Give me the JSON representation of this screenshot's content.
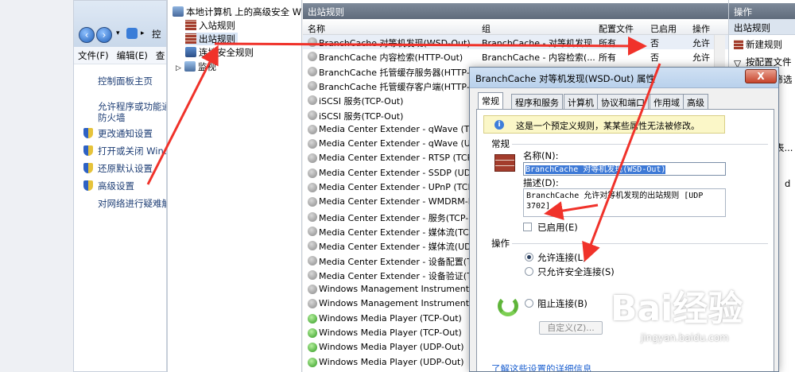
{
  "control_panel": {
    "address_fragment": "控",
    "menu": [
      "文件(F)",
      "编辑(E)",
      "查"
    ],
    "links": [
      "控制面板主页",
      "允许程序或功能通",
      "防火墙",
      "更改通知设置",
      "打开或关闭 Windo",
      "还原默认设置",
      "高级设置",
      "对网络进行疑难解"
    ]
  },
  "tree": {
    "root": "本地计算机 上的高级安全 Win",
    "inbound": "入站规则",
    "outbound": "出站规则",
    "connection": "连接安全规则",
    "monitor": "监视"
  },
  "list": {
    "title": "出站规则",
    "columns": {
      "name": "名称",
      "group": "组",
      "profile": "配置文件",
      "enabled": "已启用",
      "action": "操作"
    },
    "rows": [
      {
        "name": "BranchCache 对等机发现(WSD-Out)",
        "group": "BranchCache - 对等机发现",
        "profile": "所有",
        "enabled": "否",
        "action": "允许",
        "green": false
      },
      {
        "name": "BranchCache 内容检索(HTTP-Out)",
        "group": "BranchCache - 内容检索(...",
        "profile": "所有",
        "enabled": "否",
        "action": "允许",
        "green": false
      },
      {
        "name": "BranchCache 托管缓存服务器(HTTP-Out)",
        "group": "",
        "profile": "",
        "enabled": "",
        "action": "",
        "green": false
      },
      {
        "name": "BranchCache 托管缓存客户端(HTTP-Out)",
        "group": "",
        "profile": "",
        "enabled": "",
        "action": "",
        "green": false
      },
      {
        "name": "iSCSI 服务(TCP-Out)",
        "group": "",
        "profile": "",
        "enabled": "",
        "action": "",
        "green": false
      },
      {
        "name": "iSCSI 服务(TCP-Out)",
        "group": "",
        "profile": "",
        "enabled": "",
        "action": "",
        "green": false
      },
      {
        "name": "Media Center Extender - qWave (TCP",
        "group": "",
        "profile": "",
        "enabled": "",
        "action": "",
        "green": false
      },
      {
        "name": "Media Center Extender - qWave (UD",
        "group": "",
        "profile": "",
        "enabled": "",
        "action": "",
        "green": false
      },
      {
        "name": "Media Center Extender - RTSP (TCP-",
        "group": "",
        "profile": "",
        "enabled": "",
        "action": "",
        "green": false
      },
      {
        "name": "Media Center Extender - SSDP (UDP-",
        "group": "",
        "profile": "",
        "enabled": "",
        "action": "",
        "green": false
      },
      {
        "name": "Media Center Extender - UPnP (TCP-",
        "group": "",
        "profile": "",
        "enabled": "",
        "action": "",
        "green": false
      },
      {
        "name": "Media Center Extender - WMDRM-N",
        "group": "",
        "profile": "",
        "enabled": "",
        "action": "",
        "green": false
      },
      {
        "name": "Media Center Extender - 服务(TCP-O",
        "group": "",
        "profile": "",
        "enabled": "",
        "action": "",
        "green": false
      },
      {
        "name": "Media Center Extender - 媒体流(TCP-",
        "group": "",
        "profile": "",
        "enabled": "",
        "action": "",
        "green": false
      },
      {
        "name": "Media Center Extender - 媒体流(UDP",
        "group": "",
        "profile": "",
        "enabled": "",
        "action": "",
        "green": false
      },
      {
        "name": "Media Center Extender - 设备配置(TC",
        "group": "",
        "profile": "",
        "enabled": "",
        "action": "",
        "green": false
      },
      {
        "name": "Media Center Extender - 设备验证(TC",
        "group": "",
        "profile": "",
        "enabled": "",
        "action": "",
        "green": false
      },
      {
        "name": "Windows Management Instrumentati",
        "group": "",
        "profile": "",
        "enabled": "",
        "action": "",
        "green": false
      },
      {
        "name": "Windows Management Instrumentatio",
        "group": "",
        "profile": "",
        "enabled": "",
        "action": "",
        "green": false
      },
      {
        "name": "Windows Media Player (TCP-Out)",
        "group": "",
        "profile": "",
        "enabled": "",
        "action": "",
        "green": true
      },
      {
        "name": "Windows Media Player (TCP-Out)",
        "group": "",
        "profile": "",
        "enabled": "",
        "action": "",
        "green": true
      },
      {
        "name": "Windows Media Player (UDP-Out)",
        "group": "",
        "profile": "",
        "enabled": "",
        "action": "",
        "green": true
      },
      {
        "name": "Windows Media Player (UDP-Out)",
        "group": "",
        "profile": "",
        "enabled": "",
        "action": "",
        "green": true
      }
    ]
  },
  "actions": {
    "title": "操作",
    "section": "出站规则",
    "new_rule": "新建规则",
    "filter_profile": "按配置文件",
    "filter_state": "按状态筛选",
    "partial1": "表...",
    "partial2": "d"
  },
  "dialog": {
    "title": "BranchCache 对等机发现(WSD-Out) 属性",
    "close": "X",
    "tabs": [
      "常规",
      "程序和服务",
      "计算机",
      "协议和端口",
      "作用域",
      "高级"
    ],
    "info": "这是一个预定义规则，某某些属性无法被修改。",
    "general_group": "常规",
    "name_label": "名称(N):",
    "name_value": "BranchCache 对等机发现(WSD-Out)",
    "desc_label": "描述(D):",
    "desc_value": "BranchCache 允许对等机发现的出站规则 [UDP 3702]",
    "enabled_label": "已启用(E)",
    "enabled": false,
    "action_group": "操作",
    "allow": "允许连接(L)",
    "allow_secure": "只允许安全连接(S)",
    "custom": "自定义(Z)...",
    "block": "阻止连接(B)",
    "selected": "allow",
    "more_link": "了解这些设置的详细信息"
  },
  "watermark": {
    "main": "Bai经验",
    "url": "jingyan.baidu.com"
  }
}
